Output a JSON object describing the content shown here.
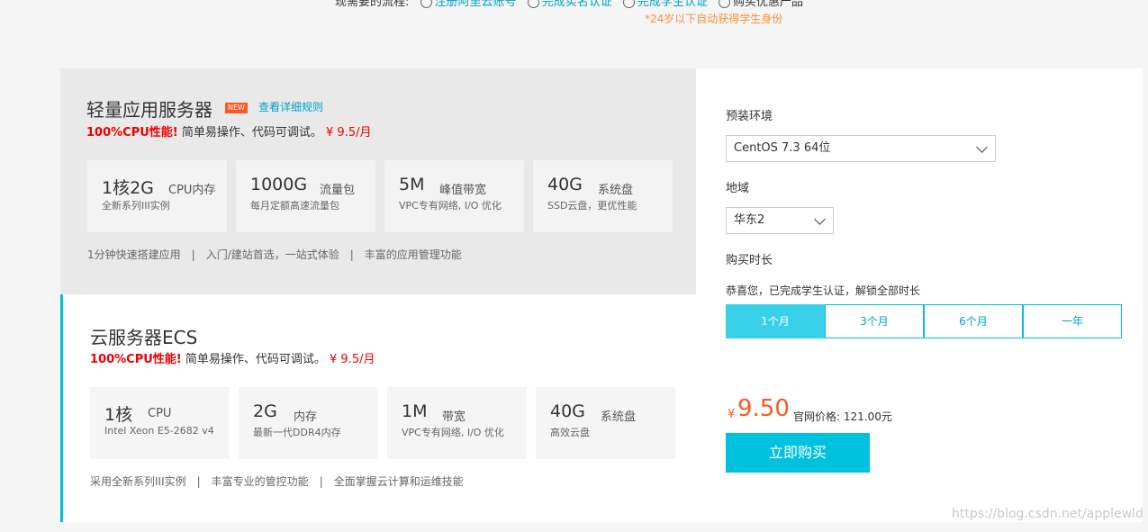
{
  "top": {
    "steps_prefix": "现需要的流程:",
    "steps": [
      "注册阿里云账号",
      "完成实名认证",
      "完成学生认证"
    ],
    "steps_suffix": "购买优惠产品",
    "note": "*24岁以下自动获得学生身份"
  },
  "lite": {
    "title": "轻量应用服务器",
    "badge": "NEW",
    "detail_link": "查看详细规则",
    "promo_highlight": "100%CPU性能!",
    "promo_text": "简单易操作、代码可调试。",
    "promo_price": "¥ 9.5/月",
    "specs": [
      {
        "big": "1核2G",
        "unit": "CPU内存",
        "desc": "全新系列III实例"
      },
      {
        "big": "1000G",
        "unit": "流量包",
        "desc": "每月定额高速流量包"
      },
      {
        "big": "5M",
        "unit": "峰值带宽",
        "desc": "VPC专有网络, I/O 优化"
      },
      {
        "big": "40G",
        "unit": "系统盘",
        "desc": "SSD云盘，更优性能"
      }
    ],
    "features": [
      "1分钟快速搭建应用",
      "入门/建站首选，一站式体验",
      "丰富的应用管理功能"
    ]
  },
  "ecs": {
    "title": "云服务器ECS",
    "promo_highlight": "100%CPU性能!",
    "promo_text": "简单易操作、代码可调试。",
    "promo_price": "¥ 9.5/月",
    "specs": [
      {
        "big": "1核",
        "unit": "CPU",
        "desc": "Intel Xeon E5-2682 v4"
      },
      {
        "big": "2G",
        "unit": "内存",
        "desc": "最新一代DDR4内存"
      },
      {
        "big": "1M",
        "unit": "带宽",
        "desc": "VPC专有网络, I/O 优化"
      },
      {
        "big": "40G",
        "unit": "系统盘",
        "desc": "高效云盘"
      }
    ],
    "features": [
      "采用全新系列III实例",
      "丰富专业的管控功能",
      "全面掌握云计算和运维技能"
    ]
  },
  "panel": {
    "env_label": "预装环境",
    "env_value": "CentOS 7.3 64位",
    "region_label": "地域",
    "region_value": "华东2",
    "duration_label": "购买时长",
    "notice": "恭喜您，已完成学生认证，解锁全部时长",
    "durations": [
      "1个月",
      "3个月",
      "6个月",
      "一年"
    ],
    "selected_duration": "1个月",
    "currency": "¥",
    "price": "9.50",
    "official_price": "官网价格: 121.00元",
    "buy_label": "立即购买"
  },
  "watermark": "https://blog.csdn.net/applewld",
  "colors": {
    "accent": "#00c1de",
    "price": "#ff5a1f",
    "promo": "#ee0000"
  }
}
